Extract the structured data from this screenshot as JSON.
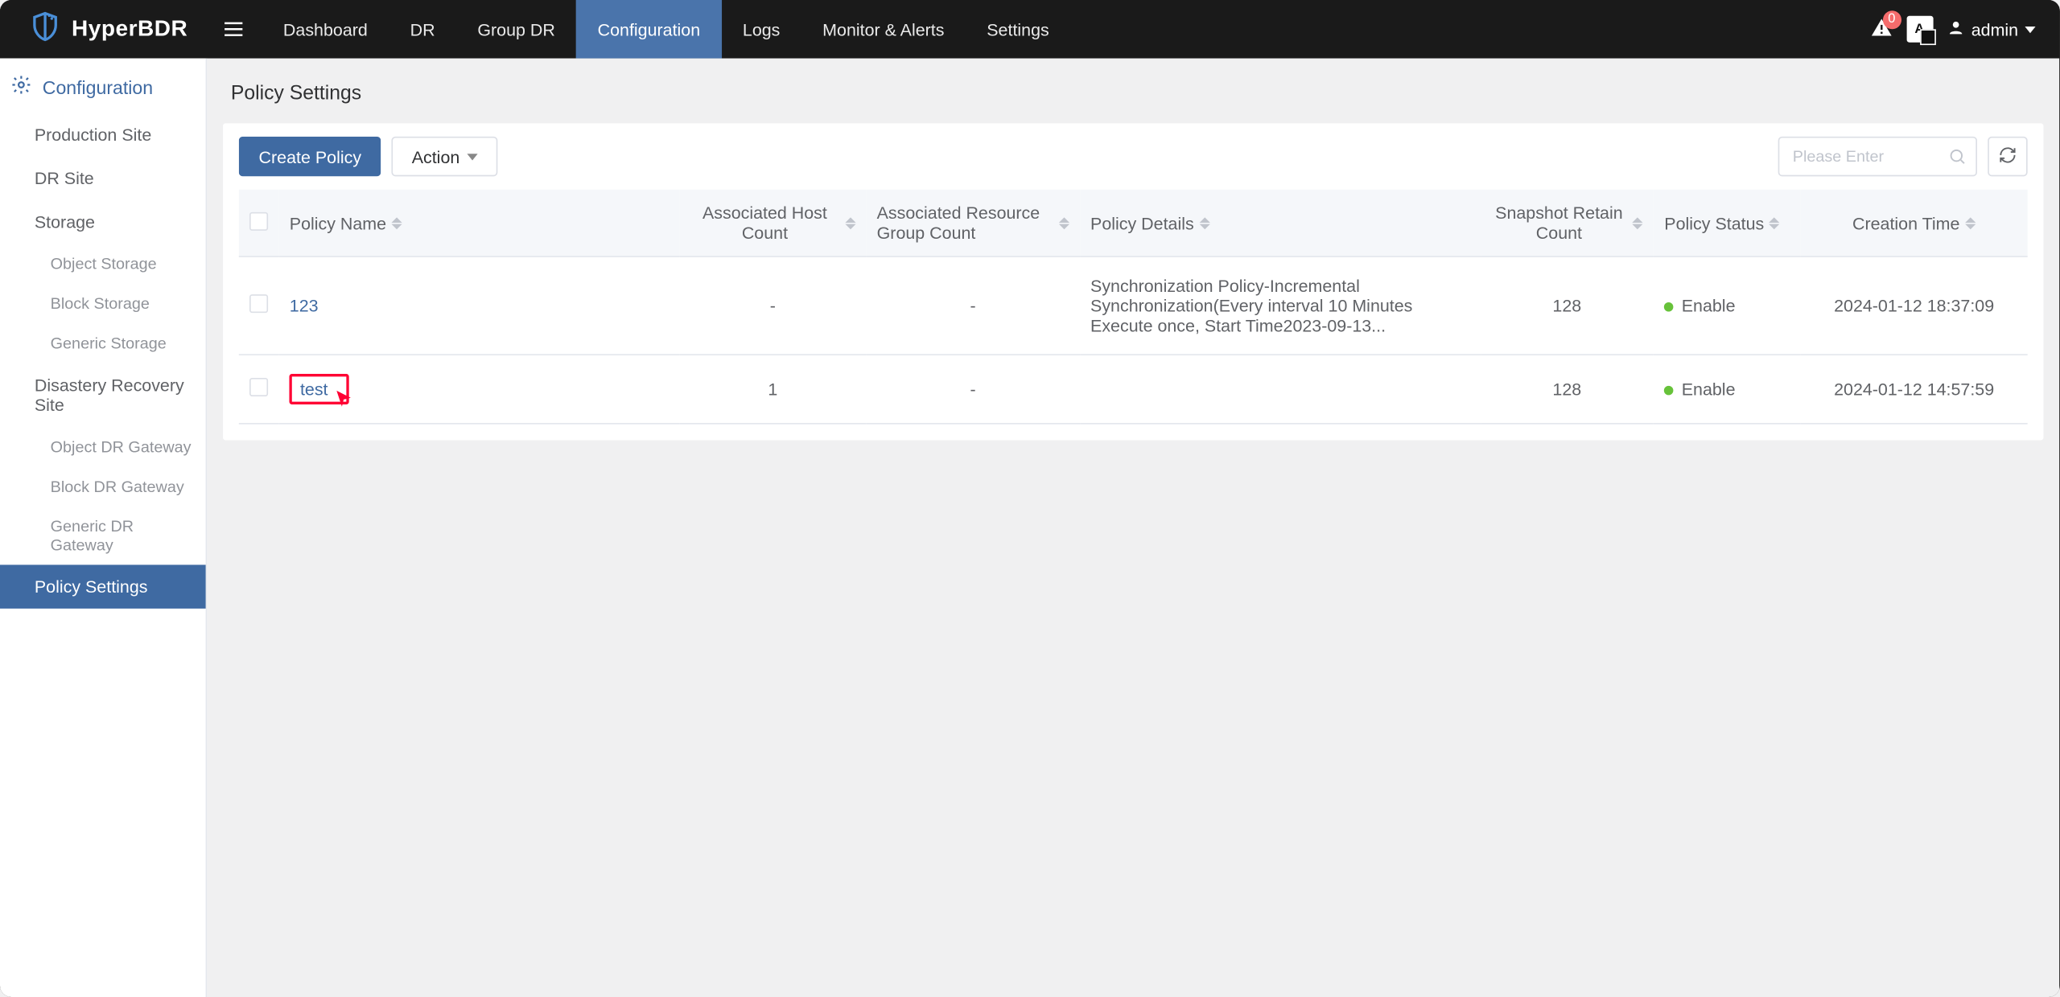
{
  "brand": {
    "name": "HyperBDR"
  },
  "topnav": {
    "items": [
      {
        "label": "Dashboard"
      },
      {
        "label": "DR"
      },
      {
        "label": "Group DR"
      },
      {
        "label": "Configuration",
        "active": true
      },
      {
        "label": "Logs"
      },
      {
        "label": "Monitor & Alerts"
      },
      {
        "label": "Settings"
      }
    ],
    "alerts_count": "0",
    "lang_label": "A",
    "user": "admin"
  },
  "sidebar": {
    "header": "Configuration",
    "groups": [
      {
        "type": "link",
        "label": "Production Site"
      },
      {
        "type": "link",
        "label": "DR Site"
      },
      {
        "type": "link",
        "label": "Storage"
      },
      {
        "type": "sub",
        "label": "Object Storage"
      },
      {
        "type": "sub",
        "label": "Block Storage"
      },
      {
        "type": "sub",
        "label": "Generic Storage"
      },
      {
        "type": "link",
        "label": "Disastery Recovery Site"
      },
      {
        "type": "sub",
        "label": "Object DR Gateway"
      },
      {
        "type": "sub",
        "label": "Block DR Gateway"
      },
      {
        "type": "sub",
        "label": "Generic DR Gateway"
      },
      {
        "type": "link",
        "label": "Policy Settings",
        "active": true
      }
    ]
  },
  "page": {
    "title": "Policy Settings"
  },
  "toolbar": {
    "create_label": "Create Policy",
    "action_label": "Action",
    "search_placeholder": "Please Enter"
  },
  "table": {
    "columns": {
      "name": "Policy Name",
      "host": "Associated Host Count",
      "res": "Associated Resource Group Count",
      "details": "Policy Details",
      "snap": "Snapshot Retain Count",
      "status": "Policy Status",
      "time": "Creation Time"
    },
    "rows": [
      {
        "name": "123",
        "host": "-",
        "res": "-",
        "details": "Synchronization Policy-Incremental Synchronization(Every interval 10 Minutes Execute once, Start Time2023-09-13...",
        "snap": "128",
        "status": "Enable",
        "time": "2024-01-12 18:37:09",
        "highlight": false
      },
      {
        "name": "test",
        "host": "1",
        "res": "-",
        "details": "",
        "snap": "128",
        "status": "Enable",
        "time": "2024-01-12 14:57:59",
        "highlight": true
      }
    ]
  }
}
